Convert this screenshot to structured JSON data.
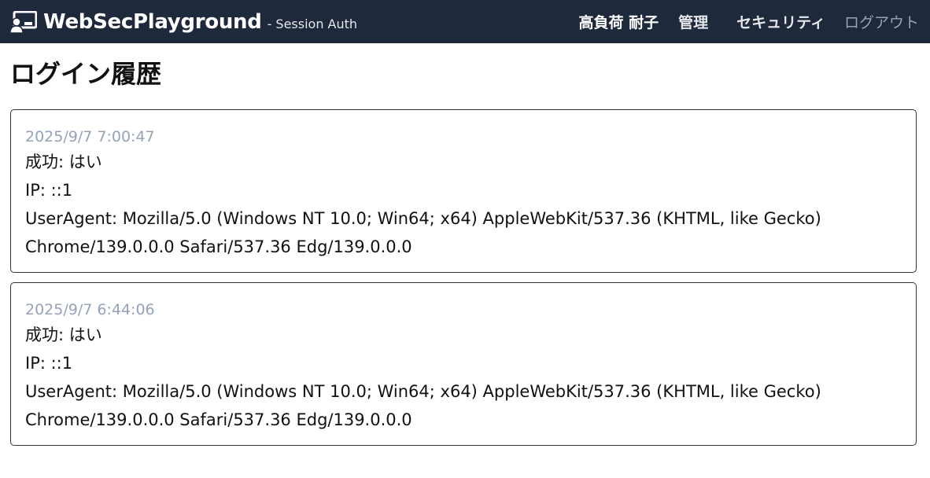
{
  "navbar": {
    "brand": "WebSecPlayground",
    "subtitle": "- Session Auth",
    "user": "高負荷 耐子",
    "admin_label": "管理",
    "security_label": "セキュリティ",
    "logout_label": "ログアウト",
    "logo_icon": "chalkboard-user-icon"
  },
  "page": {
    "title": "ログイン履歴"
  },
  "history": [
    {
      "time": "2025/9/7 7:00:47",
      "success": "成功: はい",
      "ip": "IP: ::1",
      "ua1": "UserAgent: Mozilla/5.0 (Windows NT 10.0; Win64; x64) AppleWebKit/537.36 (KHTML, like Gecko)",
      "ua2": "Chrome/139.0.0.0 Safari/537.36 Edg/139.0.0.0"
    },
    {
      "time": "2025/9/7 6:44:06",
      "success": "成功: はい",
      "ip": "IP: ::1",
      "ua1": "UserAgent: Mozilla/5.0 (Windows NT 10.0; Win64; x64) AppleWebKit/537.36 (KHTML, like Gecko)",
      "ua2": "Chrome/139.0.0.0 Safari/537.36 Edg/139.0.0.0"
    }
  ],
  "colors": {
    "navbar_bg": "#1e293b",
    "timestamp": "#94a3b8",
    "logout": "#9ca3af"
  }
}
